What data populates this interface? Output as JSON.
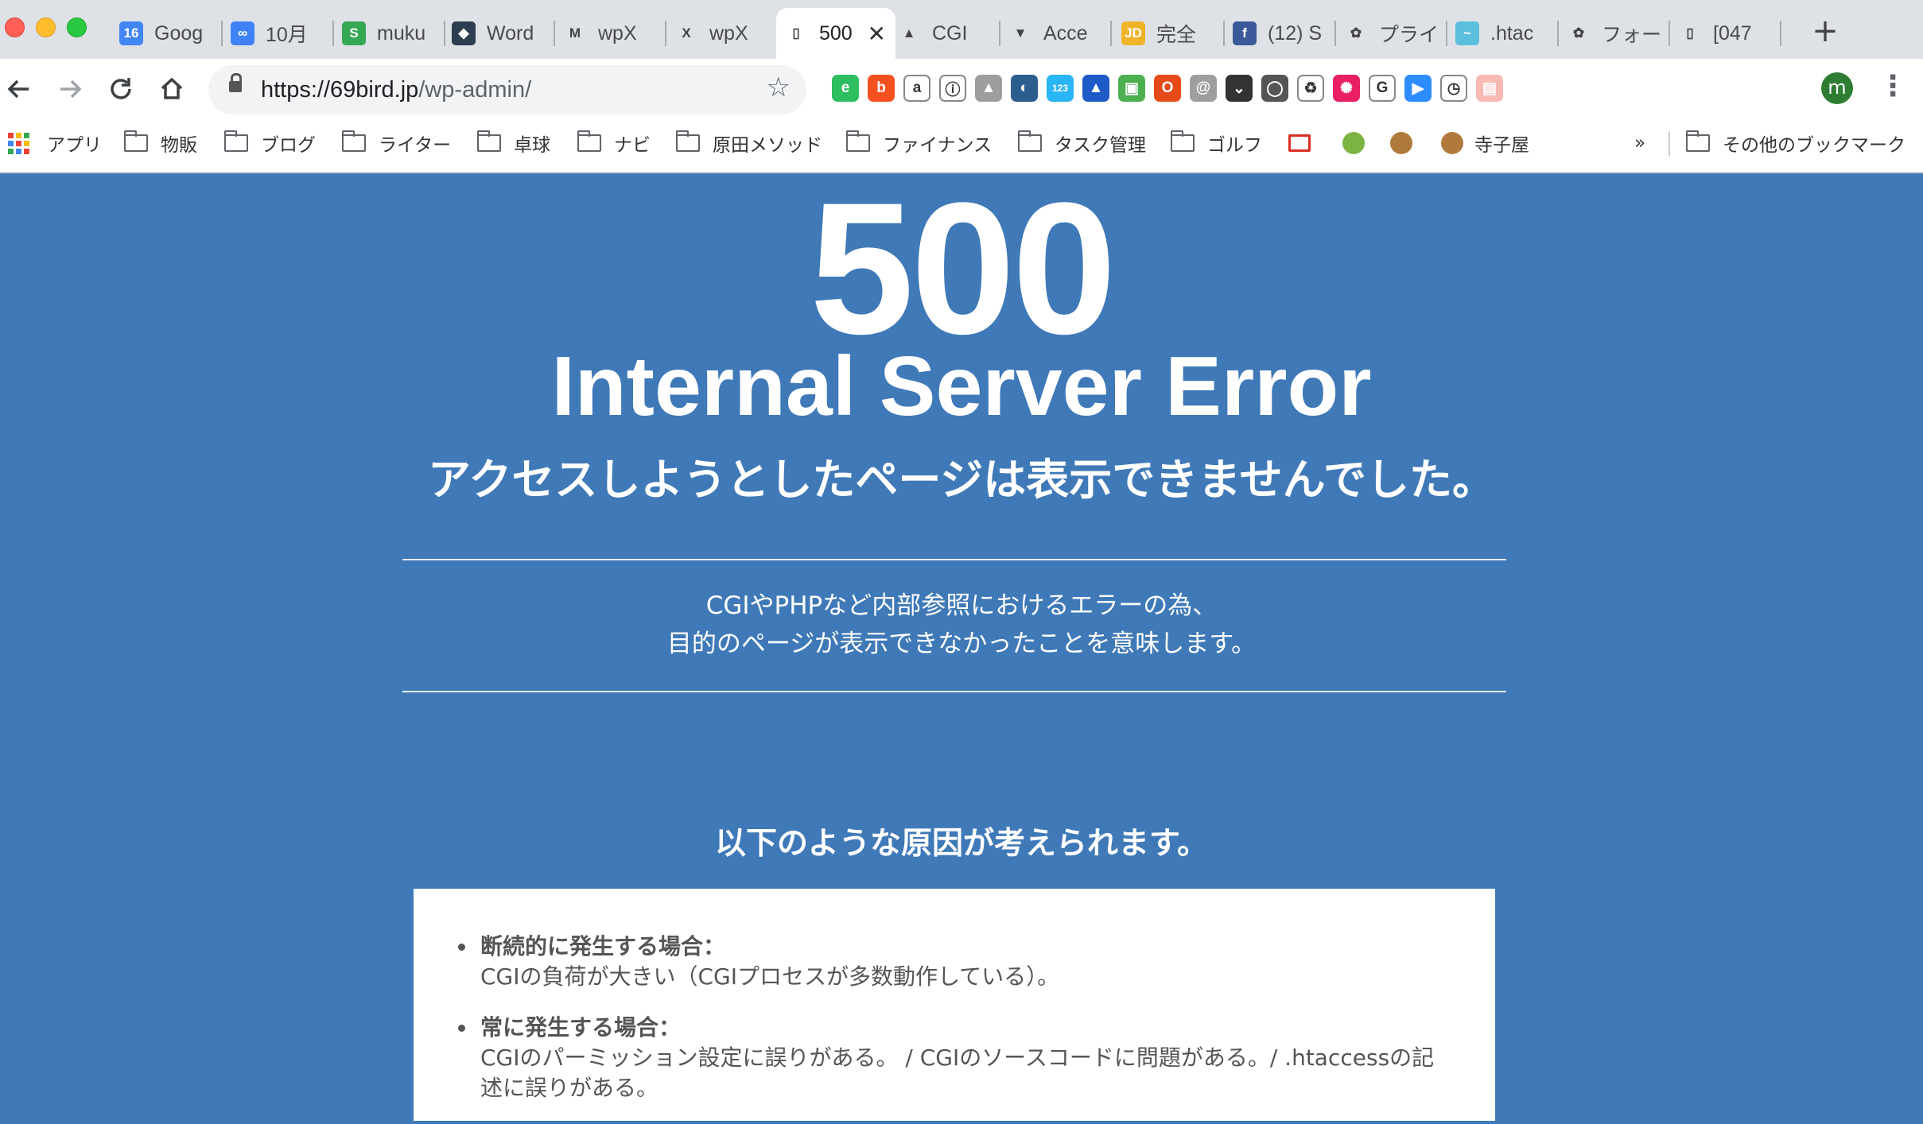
{
  "browser": {
    "tabs": [
      {
        "title": "Goog",
        "favicon": "calendar-16",
        "color": "#4285f4",
        "glyph": "16"
      },
      {
        "title": "10月",
        "favicon": "infinity",
        "color": "#3f82f7",
        "glyph": "∞"
      },
      {
        "title": "muku",
        "favicon": "s-green",
        "color": "#34a853",
        "glyph": "S"
      },
      {
        "title": "Word",
        "favicon": "cube",
        "color": "#2c3e50",
        "glyph": "◆"
      },
      {
        "title": "wpX",
        "favicon": "gmail",
        "color": "#ffffff",
        "glyph": "M"
      },
      {
        "title": "wpX",
        "favicon": "x-blue",
        "color": "#ffffff",
        "glyph": "X"
      },
      {
        "title": "500",
        "favicon": "page",
        "color": "#ffffff",
        "glyph": "▯",
        "active": true
      },
      {
        "title": "CGI",
        "favicon": "grad-cap",
        "color": "#ffffff",
        "glyph": "▲"
      },
      {
        "title": "Acce",
        "favicon": "shield",
        "color": "#ffffff",
        "glyph": "▼"
      },
      {
        "title": "完全",
        "favicon": "jd",
        "color": "#f0b429",
        "glyph": "JD"
      },
      {
        "title": "(12) S",
        "favicon": "facebook",
        "color": "#3b5998",
        "glyph": "f"
      },
      {
        "title": "プライ",
        "favicon": "red-bear",
        "color": "#ffffff",
        "glyph": "✿"
      },
      {
        "title": ".htac",
        "favicon": "wave",
        "color": "#5bc0de",
        "glyph": "~"
      },
      {
        "title": "フォー",
        "favicon": "red-bear",
        "color": "#ffffff",
        "glyph": "✿"
      },
      {
        "title": "[047",
        "favicon": "page",
        "color": "#ffffff",
        "glyph": "▯"
      }
    ],
    "new_tab": "+",
    "close_tab": "✕",
    "url_host": "https://69bird.jp",
    "url_path": "/wp-admin/",
    "avatar": "m",
    "extensions": [
      {
        "name": "evernote",
        "color": "#2dbe60",
        "glyph": "e"
      },
      {
        "name": "hatena",
        "color": "#f4511e",
        "glyph": "b"
      },
      {
        "name": "amazon",
        "color": "#ffffff",
        "glyph": "a"
      },
      {
        "name": "info",
        "color": "#ffffff",
        "glyph": "ⓘ"
      },
      {
        "name": "drive",
        "color": "#9e9e9e",
        "glyph": "▲"
      },
      {
        "name": "tab-manager",
        "color": "#2c5d8f",
        "glyph": "◐"
      },
      {
        "name": "counter",
        "color": "#29b6f6",
        "glyph": "123"
      },
      {
        "name": "bell",
        "color": "#1e5bc6",
        "glyph": "▲"
      },
      {
        "name": "doc-green",
        "color": "#4caf50",
        "glyph": "▣"
      },
      {
        "name": "office",
        "color": "#e64a19",
        "glyph": "O"
      },
      {
        "name": "at-mail",
        "color": "#9e9e9e",
        "glyph": "@"
      },
      {
        "name": "pocket",
        "color": "#333333",
        "glyph": "⌄"
      },
      {
        "name": "bulb",
        "color": "#555555",
        "glyph": "◯"
      },
      {
        "name": "recycle",
        "color": "#ffffff",
        "glyph": "♻"
      },
      {
        "name": "color-wheel",
        "color": "#e91e63",
        "glyph": "✺"
      },
      {
        "name": "g-box",
        "color": "#eeeeee",
        "glyph": "G"
      },
      {
        "name": "zoom",
        "color": "#2d8cff",
        "glyph": "▶"
      },
      {
        "name": "timer",
        "color": "#ffffff",
        "glyph": "◷"
      },
      {
        "name": "screenshot",
        "color": "#f8bbb4",
        "glyph": "▤"
      }
    ],
    "bookmarks": [
      {
        "label": "アプリ",
        "kind": "apps"
      },
      {
        "label": "物販",
        "kind": "folder"
      },
      {
        "label": "ブログ",
        "kind": "folder"
      },
      {
        "label": "ライター",
        "kind": "folder"
      },
      {
        "label": "卓球",
        "kind": "folder"
      },
      {
        "label": "ナビ",
        "kind": "folder"
      },
      {
        "label": "原田メソッド",
        "kind": "folder"
      },
      {
        "label": "ファイナンス",
        "kind": "folder"
      },
      {
        "label": "タスク管理",
        "kind": "folder"
      },
      {
        "label": "ゴルフ",
        "kind": "folder"
      },
      {
        "label": "",
        "kind": "gmail"
      },
      {
        "label": "",
        "kind": "figure"
      },
      {
        "label": "",
        "kind": "cookie"
      },
      {
        "label": "寺子屋",
        "kind": "cookie"
      }
    ],
    "bookmarks_overflow": "»",
    "other_bookmarks": "その他のブックマーク"
  },
  "error_page": {
    "code": "500",
    "title": "Internal Server Error",
    "subtitle": "アクセスしようとしたページは表示できませんでした。",
    "explain_line1": "CGIやPHPなど内部参照におけるエラーの為、",
    "explain_line2": "目的のページが表示できなかったことを意味します。",
    "causes_heading": "以下のような原因が考えられます。",
    "causes": [
      {
        "heading": "断続的に発生する場合：",
        "body": "CGIの負荷が大きい（CGIプロセスが多数動作している）。"
      },
      {
        "heading": "常に発生する場合：",
        "body": "CGIのパーミッション設定に誤りがある。 / CGIのソースコードに問題がある。/ .htaccessの記述に誤りがある。"
      }
    ]
  },
  "colors": {
    "page_background": "#3f79b8",
    "card_background": "#ffffff"
  }
}
